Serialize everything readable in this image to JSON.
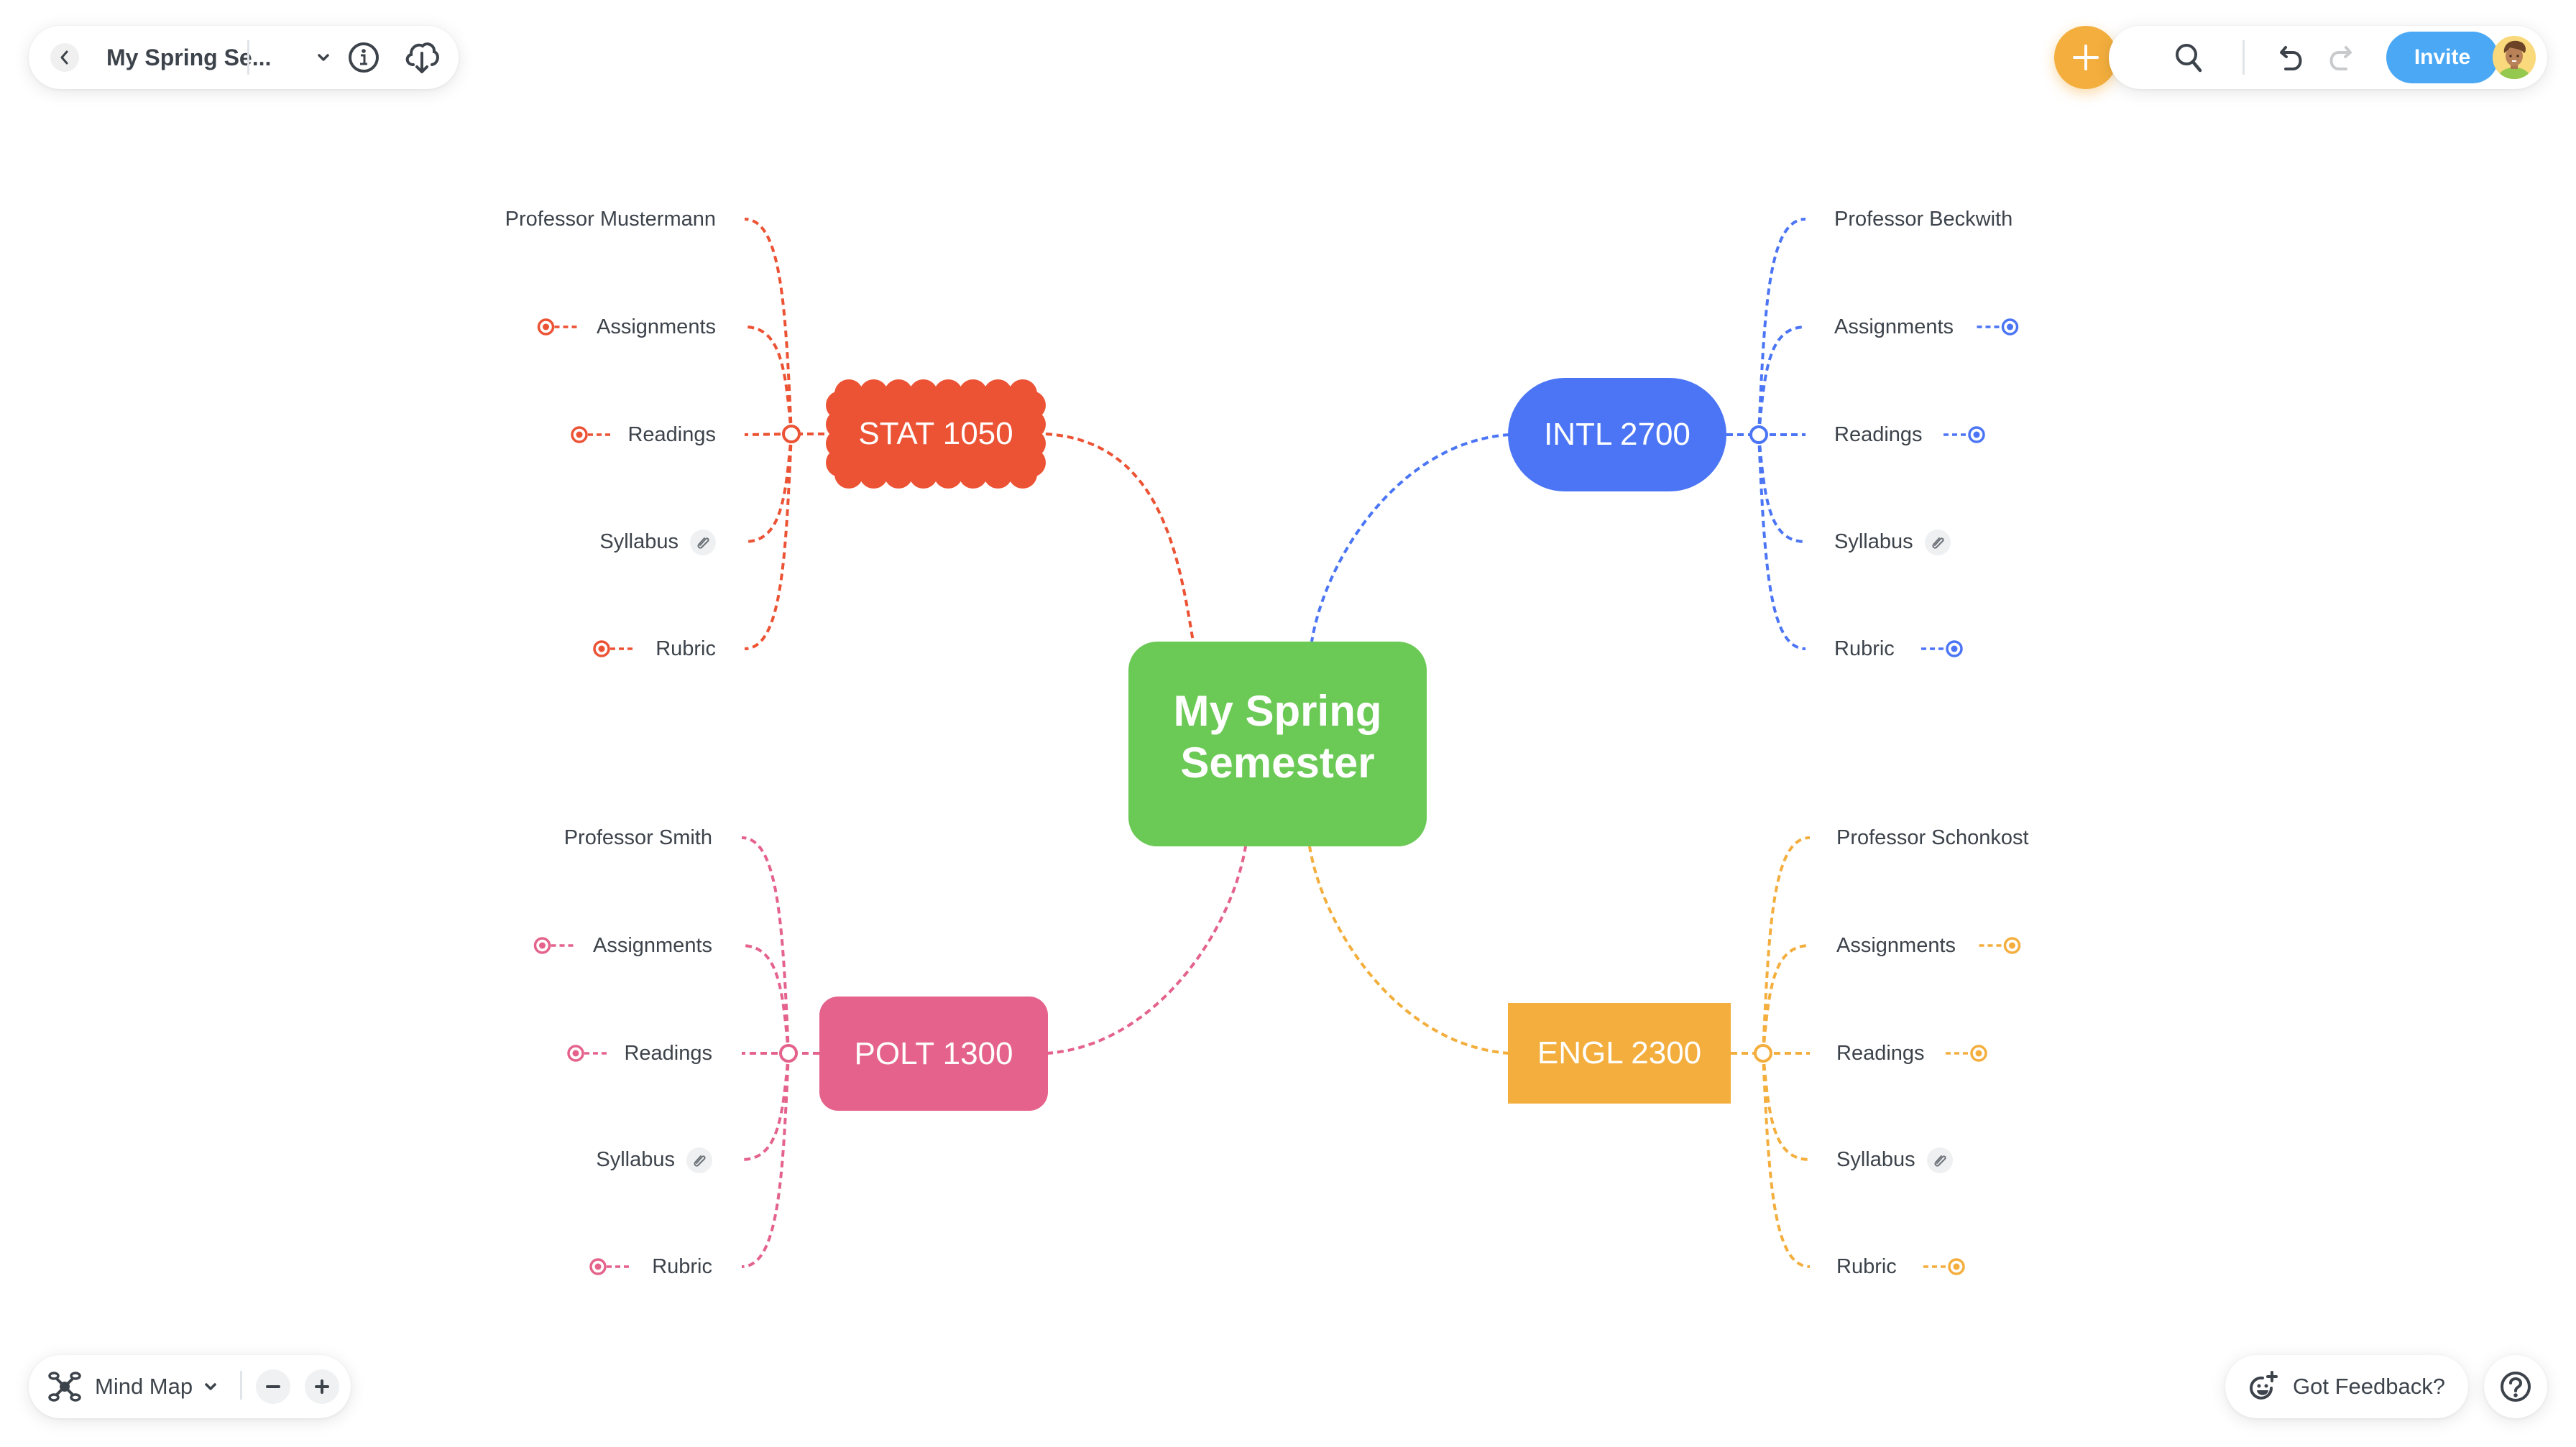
{
  "topbar": {
    "back_icon": "chevron-left-icon",
    "title": "My Spring Se...",
    "title_dropdown_icon": "chevron-down-icon",
    "info_icon": "info-icon",
    "download_icon": "cloud-download-icon"
  },
  "top_right": {
    "add_icon": "plus-icon",
    "add_color": "#f3ae3d",
    "search_icon": "search-icon",
    "undo_icon": "undo-icon",
    "redo_icon": "redo-icon",
    "invite_label": "Invite",
    "invite_color": "#4aa8f5",
    "avatar_icon": "user-avatar"
  },
  "bottom_left": {
    "view_icon": "mind-map-icon",
    "view_label": "Mind Map",
    "view_dropdown_icon": "chevron-down-icon",
    "zoom_out_icon": "minus-icon",
    "zoom_in_icon": "plus-icon"
  },
  "bottom_right": {
    "feedback_icon": "smiley-plus-icon",
    "feedback_label": "Got Feedback?",
    "help_icon": "help-icon"
  },
  "mindmap": {
    "root": {
      "label_line1": "My Spring",
      "label_line2": "Semester",
      "color": "#6bc955"
    },
    "branches": [
      {
        "id": "stat",
        "label": "STAT 1050",
        "color": "#ec5234",
        "shape": "cloud",
        "side": "left",
        "children": [
          {
            "label": "Professor Mustermann",
            "marker": false,
            "attachment": false
          },
          {
            "label": "Assignments",
            "marker": true,
            "attachment": false
          },
          {
            "label": "Readings",
            "marker": true,
            "attachment": false
          },
          {
            "label": "Syllabus",
            "marker": false,
            "attachment": true
          },
          {
            "label": "Rubric",
            "marker": true,
            "attachment": false
          }
        ]
      },
      {
        "id": "intl",
        "label": "INTL 2700",
        "color": "#4b75f5",
        "shape": "stadium",
        "side": "right",
        "children": [
          {
            "label": "Professor Beckwith",
            "marker": false,
            "attachment": false
          },
          {
            "label": "Assignments",
            "marker": true,
            "attachment": false
          },
          {
            "label": "Readings",
            "marker": true,
            "attachment": false
          },
          {
            "label": "Syllabus",
            "marker": false,
            "attachment": true
          },
          {
            "label": "Rubric",
            "marker": true,
            "attachment": false
          }
        ]
      },
      {
        "id": "polt",
        "label": "POLT 1300",
        "color": "#e4628b",
        "shape": "rounded",
        "side": "left",
        "children": [
          {
            "label": "Professor Smith",
            "marker": false,
            "attachment": false
          },
          {
            "label": "Assignments",
            "marker": true,
            "attachment": false
          },
          {
            "label": "Readings",
            "marker": true,
            "attachment": false
          },
          {
            "label": "Syllabus",
            "marker": false,
            "attachment": true
          },
          {
            "label": "Rubric",
            "marker": true,
            "attachment": false
          }
        ]
      },
      {
        "id": "engl",
        "label": "ENGL 2300",
        "color": "#f3ae3d",
        "shape": "rect",
        "side": "right",
        "children": [
          {
            "label": "Professor Schonkost",
            "marker": false,
            "attachment": false
          },
          {
            "label": "Assignments",
            "marker": true,
            "attachment": false
          },
          {
            "label": "Readings",
            "marker": true,
            "attachment": false
          },
          {
            "label": "Syllabus",
            "marker": false,
            "attachment": true
          },
          {
            "label": "Rubric",
            "marker": true,
            "attachment": false
          }
        ]
      }
    ]
  }
}
